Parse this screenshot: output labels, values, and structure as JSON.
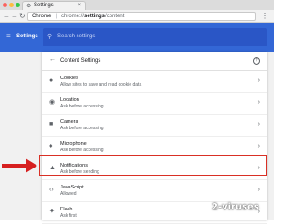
{
  "browser": {
    "tab_title": "Settings",
    "tab_close": "×",
    "omnibox_site": "Chrome",
    "omnibox_sep": "|",
    "omnibox_prefix": "chrome://",
    "omnibox_path_bold": "settings",
    "omnibox_path_rest": "/content",
    "back_glyph": "←",
    "forward_glyph": "→",
    "reload_glyph": "↻",
    "menu_glyph": "⋮",
    "traffic_colors": [
      "#fc605c",
      "#fdbc40",
      "#34c84a"
    ]
  },
  "header": {
    "menu_glyph": "≡",
    "title": "Settings",
    "search_placeholder": "Search settings",
    "search_glyph": "⚲",
    "color": "#3367d6"
  },
  "card": {
    "title": "Content Settings",
    "back_glyph": "←",
    "help_glyph": "?",
    "rows": [
      {
        "icon": "cookie-icon",
        "glyph": "●",
        "title": "Cookies",
        "subtitle": "Allow sites to save and read cookie data"
      },
      {
        "icon": "location-icon",
        "glyph": "◉",
        "title": "Location",
        "subtitle": "Ask before accessing"
      },
      {
        "icon": "camera-icon",
        "glyph": "■",
        "title": "Camera",
        "subtitle": "Ask before accessing"
      },
      {
        "icon": "microphone-icon",
        "glyph": "♦",
        "title": "Microphone",
        "subtitle": "Ask before accessing"
      },
      {
        "icon": "notifications-icon",
        "glyph": "▲",
        "title": "Notifications",
        "subtitle": "Ask before sending"
      },
      {
        "icon": "javascript-icon",
        "glyph": "‹›",
        "title": "JavaScript",
        "subtitle": "Allowed"
      },
      {
        "icon": "flash-icon",
        "glyph": "✦",
        "title": "Flash",
        "subtitle": "Ask first"
      }
    ],
    "chevron": "›"
  },
  "annotation": {
    "highlight_color": "#d93025",
    "arrow_color": "#d61f1f"
  },
  "watermark": "2-viruses"
}
